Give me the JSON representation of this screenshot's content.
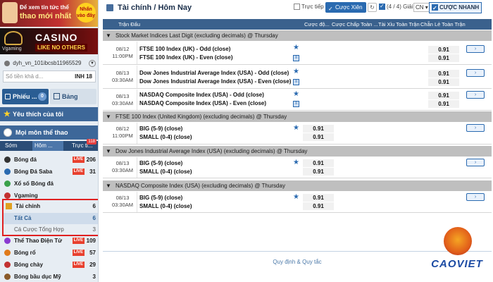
{
  "colors": {
    "accent": "#2a6ab0",
    "header": "#3a618d",
    "live": "#e8402e",
    "highlight_box": "#e02020"
  },
  "banner1": {
    "line1": "Để xem tin tức thể",
    "line2": "thao mới nhất",
    "badge": "Nhấn vào đây"
  },
  "banner2": {
    "casino": "CASINO",
    "like": "LIKE NO OTHERS",
    "brand": "Vgaming"
  },
  "user": {
    "name": "dyh_vn_101ibcsb11965529",
    "balance_placeholder": "Số tiền khả d...",
    "currency": "INH 18"
  },
  "buttons": {
    "phieu": "Phiếu ...",
    "phieu_count": "0",
    "bang": "Bảng Cược"
  },
  "nav": {
    "favorites": "Yêu thích của tôi",
    "all_sports": "Mọi môn thể thao",
    "tabs": [
      {
        "label": "Sớm"
      },
      {
        "label": "Hôm ..."
      },
      {
        "label": "Trực ti..."
      }
    ],
    "live_count": "118"
  },
  "sports": [
    {
      "name": "Bóng đá",
      "live": "LIVE",
      "count": "206",
      "icon_color": "#333"
    },
    {
      "name": "Bóng Đá Saba",
      "live": "LIVE",
      "count": "31",
      "icon_color": "#2a6ab0"
    },
    {
      "name": "Xổ số Bóng đá",
      "live": "",
      "count": "",
      "icon_color": "#3aa14a"
    },
    {
      "name": "Vgaming",
      "live": "",
      "count": "",
      "icon_color": "#c23131"
    }
  ],
  "finance": {
    "label": "Tài chính",
    "count": "6",
    "sub": [
      {
        "label": "Tất Cả",
        "count": "6"
      },
      {
        "label": "Cá Cược Tổng Hợp",
        "count": "3"
      }
    ]
  },
  "sports2": [
    {
      "name": "Thể Thao Điện Tử",
      "live": "LIVE",
      "count": "109",
      "icon_color": "#8a3ad1"
    },
    {
      "name": "Bóng rổ",
      "live": "LIVE",
      "count": "57",
      "icon_color": "#e07a1a"
    },
    {
      "name": "Bóng chày",
      "live": "LIVE",
      "count": "29",
      "icon_color": "#c23131"
    },
    {
      "name": "Bóng bầu dục Mỹ",
      "live": "",
      "count": "3",
      "icon_color": "#8a5a2a"
    }
  ],
  "topbar": {
    "title": "Tài chính / Hôm Nay",
    "live_label": "Trực tiếp",
    "xien_label": "Cược Xiên",
    "giai_label": "(4 / 4) Giải",
    "lang": "CN",
    "fast_label": "CƯỢC NHANH"
  },
  "table": {
    "headers": [
      "Trận Đấu",
      "Cược độ...",
      "Cược Chấp Toàn ...",
      "Tài Xỉu Toàn Trận",
      "Chẵn Lẻ Toàn Trận"
    ]
  },
  "sections": [
    {
      "title": "Stock Market Indices Last Digit (excluding decimals) @ Thursday"
    },
    {
      "title": "FTSE 100 Index (United Kingdom) (excluding decimals) @ Thursday"
    },
    {
      "title": "Dow Jones Industrial Average Index (USA) (excluding decimals) @ Thursday"
    },
    {
      "title": "NASDAQ Composite Index (USA) (excluding decimals) @ Thursday"
    }
  ],
  "matches": [
    {
      "date": "08/12",
      "time": "11:00PM",
      "line1": "FTSE 100 Index (UK) - Odd (close)",
      "line2": "FTSE 100 Index (UK) - Even (close)",
      "label1": "O",
      "label2": "E",
      "odd1": "0.91",
      "odd2": "0.91"
    },
    {
      "date": "08/13",
      "time": "03:30AM",
      "line1": "Dow Jones Industrial Average Index (USA) - Odd (close)",
      "line2": "Dow Jones Industrial Average Index (USA) - Even (close)",
      "label1": "O",
      "label2": "E",
      "odd1": "0.91",
      "odd2": "0.91"
    },
    {
      "date": "08/13",
      "time": "03:30AM",
      "line1": "NASDAQ Composite Index (USA) - Odd (close)",
      "line2": "NASDAQ Composite Index (USA) - Even (close)",
      "label1": "O",
      "label2": "E",
      "odd1": "0.91",
      "odd2": "0.91"
    },
    {
      "date": "08/12",
      "time": "11:00PM",
      "line1": "BIG (5-9) (close)",
      "line2": "SMALL (0-4) (close)",
      "odd1": "0.91",
      "odd2": "0.91"
    },
    {
      "date": "08/13",
      "time": "03:30AM",
      "line1": "BIG (5-9) (close)",
      "line2": "SMALL (0-4) (close)",
      "odd1": "0.91",
      "odd2": "0.91"
    },
    {
      "date": "08/13",
      "time": "03:30AM",
      "line1": "BIG (5-9) (close)",
      "line2": "SMALL (0-4) (close)",
      "odd1": "0.91",
      "odd2": "0.91"
    }
  ],
  "go_glyph": "›",
  "footer": "Quy định & Quy tắc",
  "brand": "CAOVIET"
}
